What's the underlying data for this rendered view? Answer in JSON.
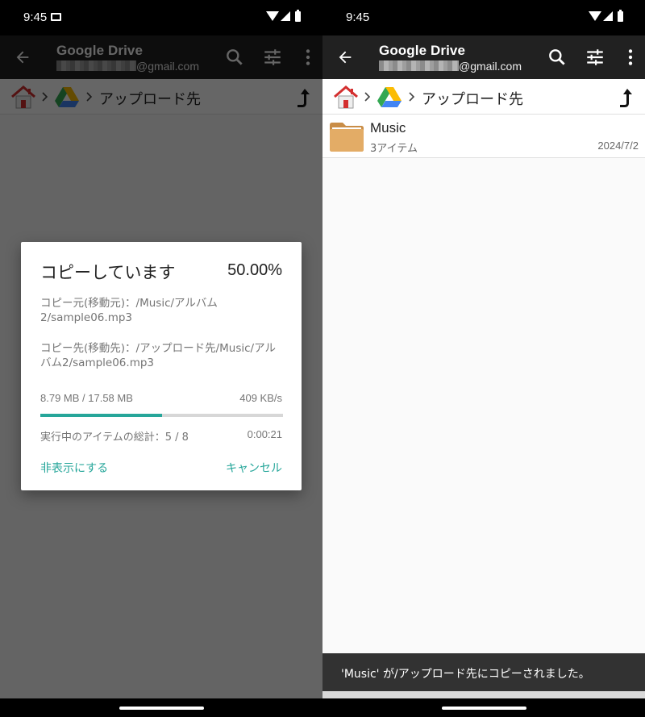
{
  "status_bar": {
    "time": "9:45"
  },
  "app_bar": {
    "title": "Google Drive",
    "account_suffix": "@gmail.com"
  },
  "breadcrumb": {
    "current_folder": "アップロード先"
  },
  "file_list": {
    "items": [
      {
        "name": "Music",
        "count": "3アイテム",
        "date": "2024/7/2"
      }
    ]
  },
  "copy_dialog": {
    "title": "コピーしています",
    "percent": "50.00%",
    "progress_fraction": 0.5,
    "source": "コピー元(移動元)：/Music/アルバム2/sample06.mp3",
    "destination": "コピー先(移動先)：/アップロード先/Music/アルバム2/sample06.mp3",
    "size": "8.79 MB / 17.58 MB",
    "speed": "409 KB/s",
    "items_total": "実行中のアイテムの総計：5 / 8",
    "elapsed": "0:00:21",
    "hide_label": "非表示にする",
    "cancel_label": "キャンセル"
  },
  "snackbar": {
    "message": "'Music' が/アップロード先にコピーされました。"
  },
  "colors": {
    "accent": "#26a69a",
    "app_bar": "#212121",
    "folder": "#e3ac66",
    "snackbar": "#323232"
  },
  "icons": [
    "back-arrow-icon",
    "search-icon",
    "tune-icon",
    "more-vert-icon",
    "home-icon",
    "chevron-right-icon",
    "google-drive-icon",
    "up-arrow-icon",
    "folder-icon",
    "wifi-icon",
    "signal-icon",
    "battery-icon",
    "notification-icon"
  ]
}
